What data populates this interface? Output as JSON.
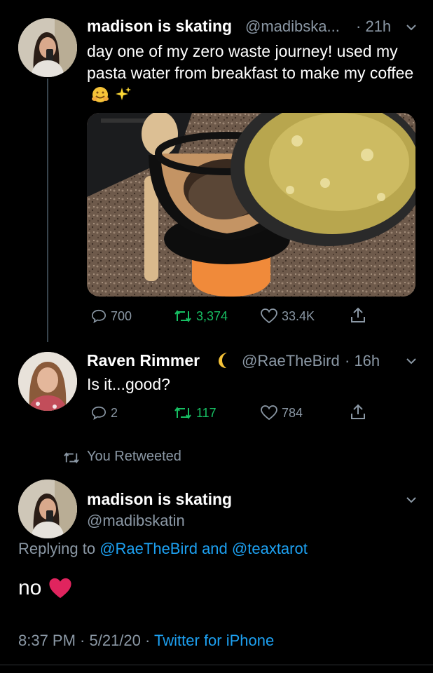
{
  "colors": {
    "background": "#000000",
    "text": "#ffffff",
    "muted": "#8b98a5",
    "link": "#1da1f2",
    "retweet_green": "#17bf63",
    "heart_red": "#e0245e"
  },
  "tweet1": {
    "name": "madison is skating",
    "handle": "@madibska...",
    "time": "· 21h",
    "text": "day one of my zero waste journey! used my pasta water from breakfast to make my coffee",
    "emojis": [
      "hugging-face",
      "sparkles"
    ],
    "replies": "700",
    "retweets": "3,374",
    "likes": "33.4K"
  },
  "tweet2": {
    "name": "Raven Rimmer",
    "handle": "@RaeTheBird",
    "time": "· 16h",
    "text": "Is it...good?",
    "replies": "2",
    "retweets": "117",
    "likes": "784"
  },
  "retweet_notice": "You Retweeted",
  "tweet3": {
    "name": "madison is skating",
    "handle": "@madibskatin",
    "replying_prefix": "Replying to",
    "replying_user1": "@RaeTheBird",
    "replying_and": "and",
    "replying_user2": "@teaxtarot",
    "text": "no",
    "timestamp": "8:37 PM · 5/21/20 ·",
    "source": "Twitter for iPhone"
  }
}
